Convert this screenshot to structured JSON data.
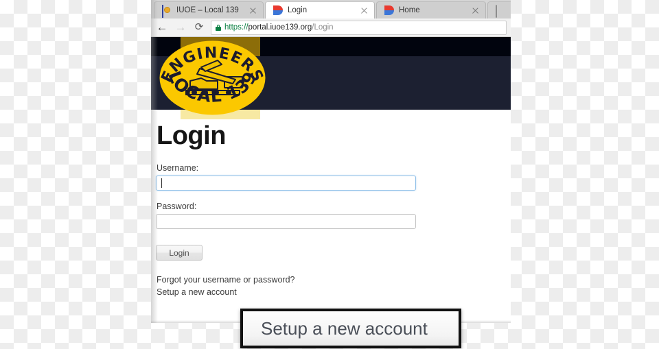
{
  "browser": {
    "tabs": [
      {
        "title": "IUOE – Local 139",
        "favicon": "iuoe-logo-icon",
        "active": false,
        "close_label": "×"
      },
      {
        "title": "Login",
        "favicon": "portal-d-icon",
        "active": true,
        "close_label": "×"
      },
      {
        "title": "Home",
        "favicon": "portal-d-icon",
        "active": false,
        "close_label": "×"
      },
      {
        "title": "",
        "favicon": "blank-page-icon",
        "active": false,
        "close_label": ""
      }
    ],
    "toolbar": {
      "back_icon": "←",
      "forward_icon": "→",
      "reload_icon": "⟳",
      "lock_icon": "padlock-secure-icon"
    },
    "address": {
      "scheme": "https://",
      "host": "portal.iuoe139.org",
      "path": "/Login",
      "full": "https://portal.iuoe139.org/Login"
    }
  },
  "site": {
    "logo": {
      "top_text": "ENGINEERS",
      "bottom_text": "LOCAL 139",
      "alt": "engineers-local-139-logo"
    },
    "header_colors": {
      "dark_band": "#01040e",
      "navy_band": "#1c2031",
      "logo_yellow": "#fbc800",
      "olive_block": "#8c6d09",
      "pale_yellow_block": "#f7e9a3"
    }
  },
  "login": {
    "title": "Login",
    "username": {
      "label": "Username:",
      "value": "",
      "placeholder": "",
      "focused": true
    },
    "password": {
      "label": "Password:",
      "value": "",
      "placeholder": "",
      "focused": false
    },
    "submit_label": "Login",
    "links": [
      {
        "label": "Forgot your username or password?"
      },
      {
        "label": "Setup a new account"
      }
    ]
  },
  "callout": {
    "text": "Setup a new account",
    "border_color": "#111111",
    "text_color": "#4a4f58"
  }
}
